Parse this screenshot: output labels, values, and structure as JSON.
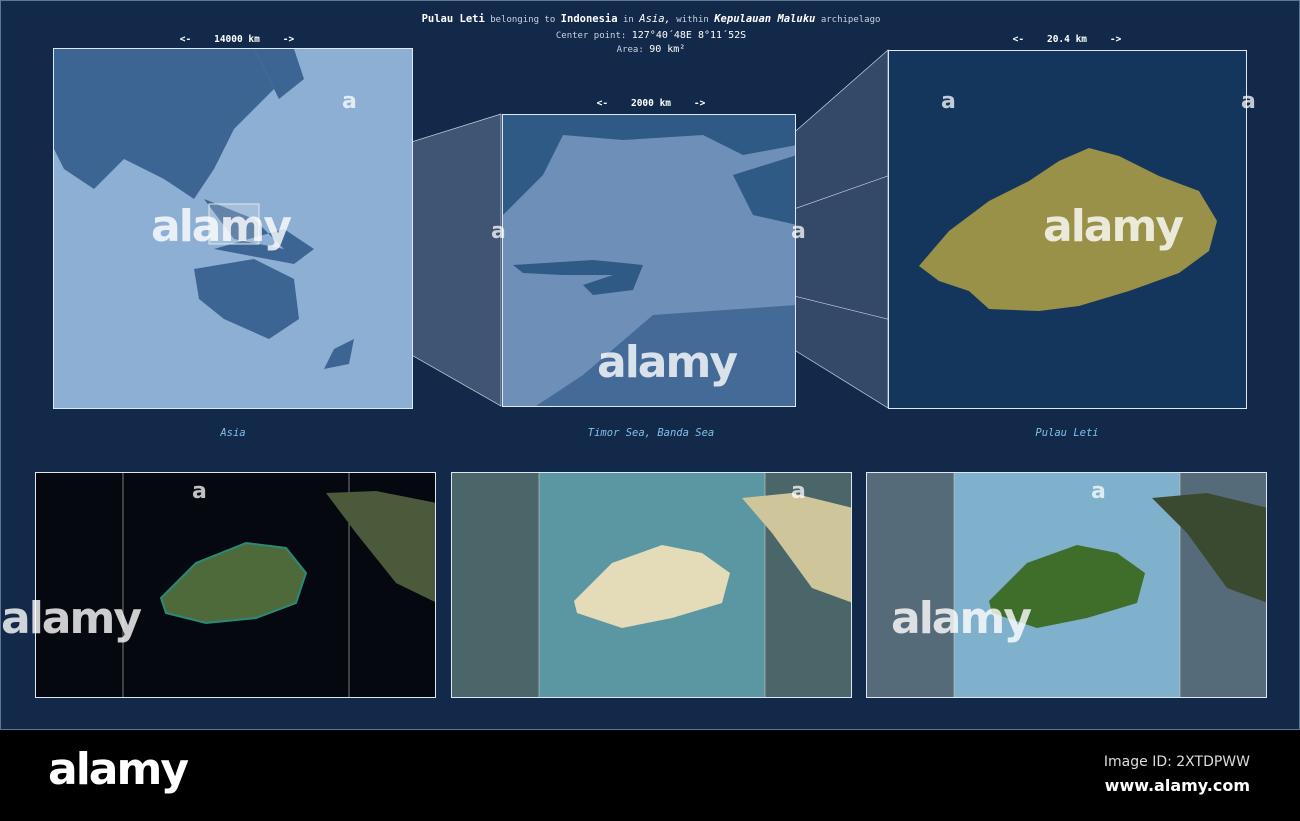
{
  "header": {
    "name": "Pulau Leti",
    "t1": "belonging to",
    "country": "Indonesia",
    "t2": "in",
    "continent": "Asia,",
    "t3": "within",
    "archipelago": "Kepulauan Maluku",
    "t4": "archipelago",
    "center_label": "Center point:",
    "center_value": "127°40´48E  8°11´52S",
    "area_label": "Area:",
    "area_value": "90 km²"
  },
  "panels": [
    {
      "scale": "<-    14000 km    ->",
      "label": "Asia"
    },
    {
      "scale": "<-    2000 km    ->",
      "label": "Timor Sea, Banda Sea"
    },
    {
      "scale": "<-    20.4 km    ->",
      "label": "Pulau Leti"
    }
  ],
  "watermark": {
    "brand": "alamy",
    "a": "a",
    "image_id": "Image ID: 2XTDPWW",
    "url": "www.alamy.com"
  },
  "colors": {
    "background": "#13294a",
    "island": "#9a9148",
    "land": "#2f5a86",
    "sea": "#8eafd4"
  }
}
